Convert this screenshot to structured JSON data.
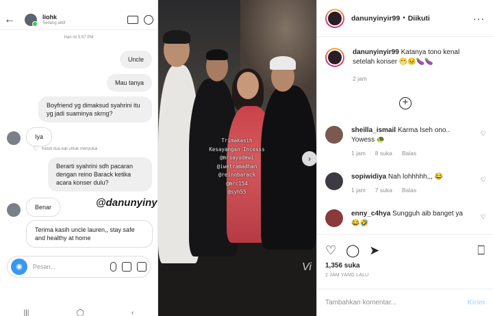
{
  "dm": {
    "contact_name": "liohk",
    "status": "Sedang aktif",
    "time_label": "Hari ini 5:57 PM",
    "messages": [
      {
        "text": "Uncle"
      },
      {
        "text": "Mau tanya"
      },
      {
        "text": "Boyfriend yg dimaksud syahrini itu yg jadi suaminya skrng?"
      },
      {
        "text": "Iya"
      },
      {
        "text": "Berarti syahrini sdh pacaran dengan reino Barack ketika acara konser dulu?"
      },
      {
        "text": "Benar"
      },
      {
        "text": "Terima kasih uncle lauren,, stay safe and healthy at home"
      }
    ],
    "reply_hint": "Ketuk dua kali untuk menyukai",
    "watermark": "@danunyinyir99",
    "input_placeholder": "Pesan..."
  },
  "photo": {
    "caption_lines": [
      "Trimakasih",
      "Kesayangan Incesss",
      "@mrsayudewi",
      "@iwetramadhan",
      "@reinobarack",
      "@mrc154",
      "@syh55"
    ],
    "corner_text": "Vi"
  },
  "ig": {
    "account": "danunyinyir99",
    "follow_status": "Diikuti",
    "caption_user": "danunyinyir99",
    "caption_text": "Katanya tono kenal setelah konser 😁😣🍆🍆",
    "caption_time": "2 jam",
    "comments": [
      {
        "user": "sheilla_ismail",
        "text": "Karma Iseh ono.. Yowess 🐢",
        "time": "1 jam",
        "likes": "8 suka",
        "reply": "Balas",
        "avatar_color": "#7a5a4e"
      },
      {
        "user": "sopiwidiya",
        "text": "Nah lohhhhh,,, 😂",
        "time": "1 jam",
        "likes": "7 suka",
        "reply": "Balas",
        "avatar_color": "#3d3a44"
      },
      {
        "user": "enny_c4hya",
        "text": "Sungguh aib banget ya 😂🤣",
        "time": "1 jam",
        "likes": "5 suka",
        "reply": "Balas",
        "avatar_color": "#8a3a3a"
      }
    ],
    "likes": "1,356 suka",
    "post_time": "2 JAM YANG LALU",
    "comment_placeholder": "Tambahkan komentar...",
    "send_label": "Kirim"
  }
}
